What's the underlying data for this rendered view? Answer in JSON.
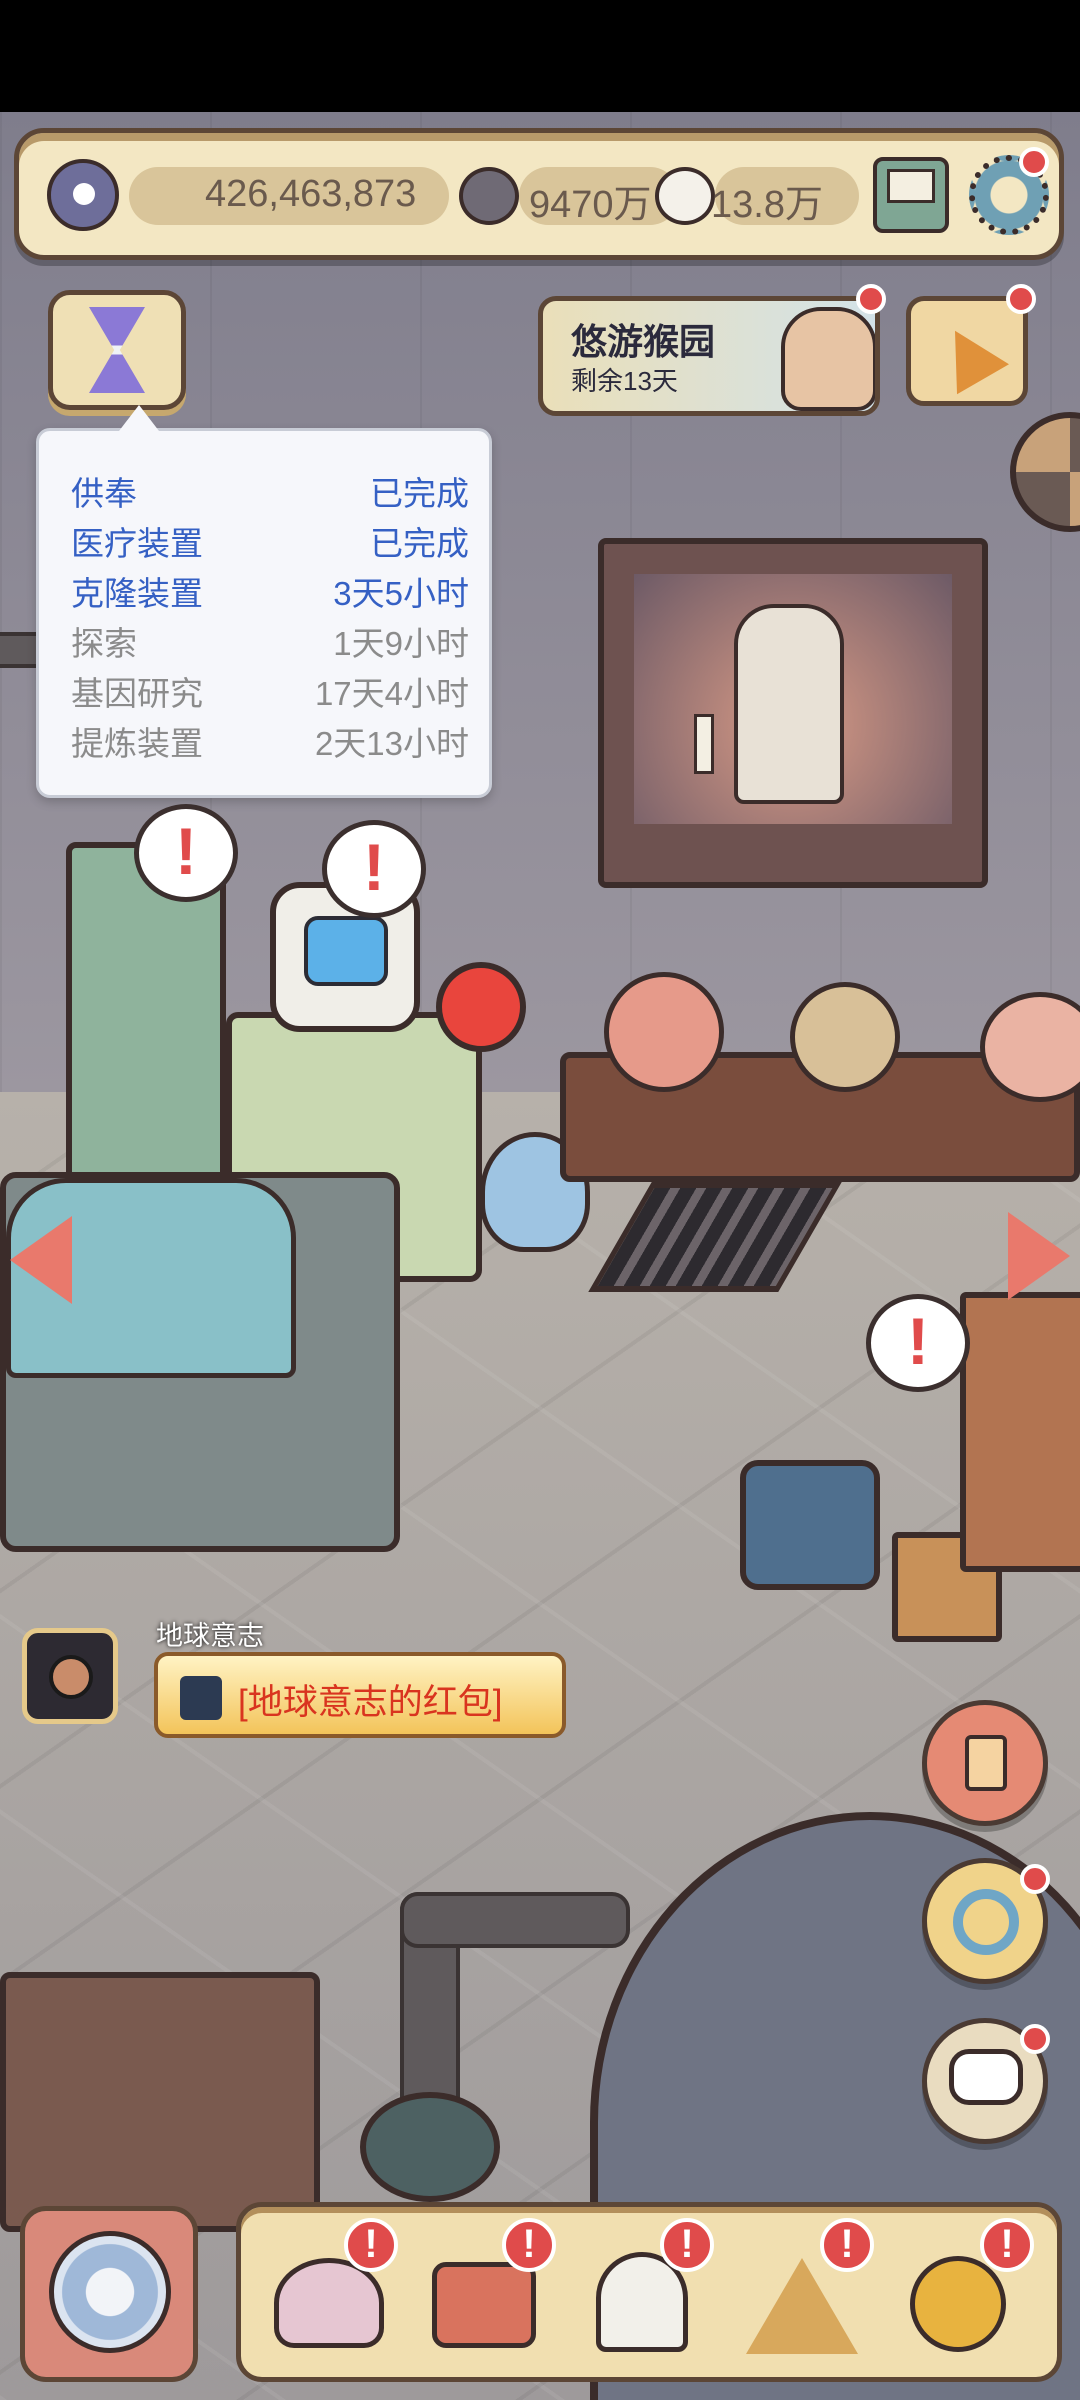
{
  "resources": {
    "eye_count": "426,463,873",
    "dark_bubble_count": "9470万",
    "light_bubble_count": "13.8万"
  },
  "event": {
    "title": "悠游猴园",
    "subtitle": "剩余13天"
  },
  "tasks": [
    {
      "name": "供奉",
      "status": "已完成",
      "style": "blue"
    },
    {
      "name": "医疗装置",
      "status": "已完成",
      "style": "blue"
    },
    {
      "name": "克隆装置",
      "status": "3天5小时",
      "style": "blue"
    },
    {
      "name": "探索",
      "status": "1天9小时",
      "style": "gray"
    },
    {
      "name": "基因研究",
      "status": "17天4小时",
      "style": "gray"
    },
    {
      "name": "提炼装置",
      "status": "2天13小时",
      "style": "gray"
    }
  ],
  "alerts": [
    "!",
    "!",
    "!"
  ],
  "red_packet": {
    "sender": "地球意志",
    "message": "[地球意志的红包]"
  },
  "bottom_nav": [
    "snail-icon",
    "toolbox-icon",
    "bust-statue-icon",
    "pyramid-eye-icon",
    "key-seal-icon"
  ],
  "nav_badge": "!",
  "colors": {
    "accent_red": "#e04b4b",
    "frame_brown": "#5c4636",
    "panel_cream": "#f3e7c3",
    "task_blue": "#3560c4",
    "task_gray": "#8b8b8b"
  }
}
